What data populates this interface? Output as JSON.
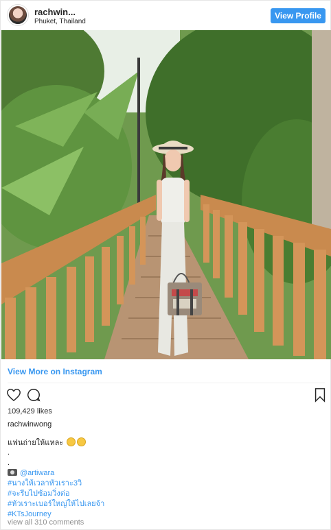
{
  "header": {
    "username": "rachwin...",
    "location": "Phuket, Thailand",
    "view_profile_label": "View Profile"
  },
  "post": {
    "view_more_label": "View More on Instagram",
    "likes": "109,429 likes",
    "owner": "rachwinwong",
    "caption": {
      "first_line": "แฟนถ่ายให้แหละ",
      "dots": [
        ".",
        "."
      ],
      "mention": "@artiwara",
      "hashtags": [
        "#นางให้เวลาหัวเราะ3วิ",
        "#จะรีบไปซ้อมวิ่งต่อ",
        "#หัวเราะเบอร์ใหญ่ให้ไปเลยจ้า",
        "#KTsJourney"
      ]
    },
    "view_all_comments": "view all 310 comments"
  },
  "icons": {
    "like": "heart-icon",
    "comment": "comment-icon",
    "save": "bookmark-icon"
  },
  "colors": {
    "accent": "#3897f0",
    "muted": "#8e8e8e"
  }
}
